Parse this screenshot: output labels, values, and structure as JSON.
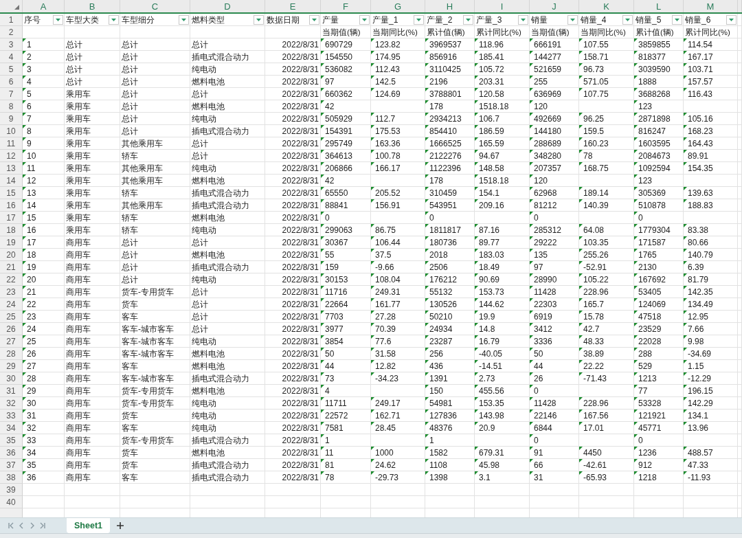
{
  "grid": {
    "columns": [
      {
        "letter": "A",
        "filter": true,
        "kind": "number"
      },
      {
        "letter": "B",
        "filter": true,
        "kind": "text"
      },
      {
        "letter": "C",
        "filter": true,
        "kind": "text"
      },
      {
        "letter": "D",
        "filter": true,
        "kind": "text"
      },
      {
        "letter": "E",
        "filter": true,
        "kind": "date"
      },
      {
        "letter": "F",
        "filter": true,
        "kind": "number"
      },
      {
        "letter": "G",
        "filter": true,
        "kind": "number"
      },
      {
        "letter": "H",
        "filter": true,
        "kind": "number"
      },
      {
        "letter": "I",
        "filter": true,
        "kind": "number"
      },
      {
        "letter": "J",
        "filter": true,
        "kind": "number"
      },
      {
        "letter": "K",
        "filter": true,
        "kind": "number"
      },
      {
        "letter": "L",
        "filter": true,
        "kind": "number"
      },
      {
        "letter": "M",
        "filter": true,
        "kind": "number"
      }
    ],
    "rows": [
      {
        "number": "1",
        "kind": "header",
        "cells": [
          "序号",
          "车型大类",
          "车型细分",
          "燃料类型",
          "数据日期",
          "产量",
          "产量_1",
          "产量_2",
          "产量_3",
          "销量",
          "销量_4",
          "销量_5",
          "销量_6"
        ]
      },
      {
        "number": "2",
        "kind": "subheader",
        "cells": [
          null,
          null,
          null,
          null,
          null,
          "当期值(辆)",
          "当期同比(%)",
          "累计值(辆)",
          "累计同比(%)",
          "当期值(辆)",
          "当期同比(%)",
          "累计值(辆)",
          "累计同比(%)"
        ]
      },
      {
        "number": "3",
        "kind": "data",
        "cells": [
          "1",
          "总计",
          "总计",
          "总计",
          "2022/8/31",
          "690729",
          "123.82",
          "3969537",
          "118.96",
          "666191",
          "107.55",
          "3859855",
          "114.54"
        ]
      },
      {
        "number": "4",
        "kind": "data",
        "cells": [
          "2",
          "总计",
          "总计",
          "插电式混合动力",
          "2022/8/31",
          "154550",
          "174.95",
          "856916",
          "185.41",
          "144277",
          "158.71",
          "818377",
          "167.17"
        ]
      },
      {
        "number": "5",
        "kind": "data",
        "cells": [
          "3",
          "总计",
          "总计",
          "纯电动",
          "2022/8/31",
          "536082",
          "112.43",
          "3110425",
          "105.72",
          "521659",
          "96.73",
          "3039590",
          "103.71"
        ]
      },
      {
        "number": "6",
        "kind": "data",
        "cells": [
          "4",
          "总计",
          "总计",
          "燃料电池",
          "2022/8/31",
          "97",
          "142.5",
          "2196",
          "203.31",
          "255",
          "571.05",
          "1888",
          "157.57"
        ]
      },
      {
        "number": "7",
        "kind": "data",
        "cells": [
          "5",
          "乘用车",
          "总计",
          "总计",
          "2022/8/31",
          "660362",
          "124.69",
          "3788801",
          "120.58",
          "636969",
          "107.75",
          "3688268",
          "116.43"
        ]
      },
      {
        "number": "8",
        "kind": "data",
        "cells": [
          "6",
          "乘用车",
          "总计",
          "燃料电池",
          "2022/8/31",
          "42",
          null,
          "178",
          "1518.18",
          "120",
          null,
          "123",
          null
        ]
      },
      {
        "number": "9",
        "kind": "data",
        "cells": [
          "7",
          "乘用车",
          "总计",
          "纯电动",
          "2022/8/31",
          "505929",
          "112.7",
          "2934213",
          "106.7",
          "492669",
          "96.25",
          "2871898",
          "105.16"
        ]
      },
      {
        "number": "10",
        "kind": "data",
        "cells": [
          "8",
          "乘用车",
          "总计",
          "插电式混合动力",
          "2022/8/31",
          "154391",
          "175.53",
          "854410",
          "186.59",
          "144180",
          "159.5",
          "816247",
          "168.23"
        ]
      },
      {
        "number": "11",
        "kind": "data",
        "cells": [
          "9",
          "乘用车",
          "其他乘用车",
          "总计",
          "2022/8/31",
          "295749",
          "163.36",
          "1666525",
          "165.59",
          "288689",
          "160.23",
          "1603595",
          "164.43"
        ]
      },
      {
        "number": "12",
        "kind": "data",
        "cells": [
          "10",
          "乘用车",
          "轿车",
          "总计",
          "2022/8/31",
          "364613",
          "100.78",
          "2122276",
          "94.67",
          "348280",
          "78",
          "2084673",
          "89.91"
        ]
      },
      {
        "number": "13",
        "kind": "data",
        "cells": [
          "11",
          "乘用车",
          "其他乘用车",
          "纯电动",
          "2022/8/31",
          "206866",
          "166.17",
          "1122396",
          "148.58",
          "207357",
          "168.75",
          "1092594",
          "154.35"
        ]
      },
      {
        "number": "14",
        "kind": "data",
        "cells": [
          "12",
          "乘用车",
          "其他乘用车",
          "燃料电池",
          "2022/8/31",
          "42",
          null,
          "178",
          "1518.18",
          "120",
          null,
          "123",
          null
        ]
      },
      {
        "number": "15",
        "kind": "data",
        "cells": [
          "13",
          "乘用车",
          "轿车",
          "插电式混合动力",
          "2022/8/31",
          "65550",
          "205.52",
          "310459",
          "154.1",
          "62968",
          "189.14",
          "305369",
          "139.63"
        ]
      },
      {
        "number": "16",
        "kind": "data",
        "cells": [
          "14",
          "乘用车",
          "其他乘用车",
          "插电式混合动力",
          "2022/8/31",
          "88841",
          "156.91",
          "543951",
          "209.16",
          "81212",
          "140.39",
          "510878",
          "188.83"
        ]
      },
      {
        "number": "17",
        "kind": "data",
        "cells": [
          "15",
          "乘用车",
          "轿车",
          "燃料电池",
          "2022/8/31",
          "0",
          null,
          "0",
          null,
          "0",
          null,
          "0",
          null
        ]
      },
      {
        "number": "18",
        "kind": "data",
        "cells": [
          "16",
          "乘用车",
          "轿车",
          "纯电动",
          "2022/8/31",
          "299063",
          "86.75",
          "1811817",
          "87.16",
          "285312",
          "64.08",
          "1779304",
          "83.38"
        ]
      },
      {
        "number": "19",
        "kind": "data",
        "cells": [
          "17",
          "商用车",
          "总计",
          "总计",
          "2022/8/31",
          "30367",
          "106.44",
          "180736",
          "89.77",
          "29222",
          "103.35",
          "171587",
          "80.66"
        ]
      },
      {
        "number": "20",
        "kind": "data",
        "cells": [
          "18",
          "商用车",
          "总计",
          "燃料电池",
          "2022/8/31",
          "55",
          "37.5",
          "2018",
          "183.03",
          "135",
          "255.26",
          "1765",
          "140.79"
        ]
      },
      {
        "number": "21",
        "kind": "data",
        "cells": [
          "19",
          "商用车",
          "总计",
          "插电式混合动力",
          "2022/8/31",
          "159",
          "-9.66",
          "2506",
          "18.49",
          "97",
          "-52.91",
          "2130",
          "6.39"
        ]
      },
      {
        "number": "22",
        "kind": "data",
        "cells": [
          "20",
          "商用车",
          "总计",
          "纯电动",
          "2022/8/31",
          "30153",
          "108.04",
          "176212",
          "90.69",
          "28990",
          "105.22",
          "167692",
          "81.79"
        ]
      },
      {
        "number": "23",
        "kind": "data",
        "cells": [
          "21",
          "商用车",
          "货车-专用货车",
          "总计",
          "2022/8/31",
          "11716",
          "249.31",
          "55132",
          "153.73",
          "11428",
          "228.96",
          "53405",
          "142.35"
        ]
      },
      {
        "number": "24",
        "kind": "data",
        "cells": [
          "22",
          "商用车",
          "货车",
          "总计",
          "2022/8/31",
          "22664",
          "161.77",
          "130526",
          "144.62",
          "22303",
          "165.7",
          "124069",
          "134.49"
        ]
      },
      {
        "number": "25",
        "kind": "data",
        "cells": [
          "23",
          "商用车",
          "客车",
          "总计",
          "2022/8/31",
          "7703",
          "27.28",
          "50210",
          "19.9",
          "6919",
          "15.78",
          "47518",
          "12.95"
        ]
      },
      {
        "number": "26",
        "kind": "data",
        "cells": [
          "24",
          "商用车",
          "客车-城市客车",
          "总计",
          "2022/8/31",
          "3977",
          "70.39",
          "24934",
          "14.8",
          "3412",
          "42.7",
          "23529",
          "7.66"
        ]
      },
      {
        "number": "27",
        "kind": "data",
        "cells": [
          "25",
          "商用车",
          "客车-城市客车",
          "纯电动",
          "2022/8/31",
          "3854",
          "77.6",
          "23287",
          "16.79",
          "3336",
          "48.33",
          "22028",
          "9.98"
        ]
      },
      {
        "number": "28",
        "kind": "data",
        "cells": [
          "26",
          "商用车",
          "客车-城市客车",
          "燃料电池",
          "2022/8/31",
          "50",
          "31.58",
          "256",
          "-40.05",
          "50",
          "38.89",
          "288",
          "-34.69"
        ]
      },
      {
        "number": "29",
        "kind": "data",
        "cells": [
          "27",
          "商用车",
          "客车",
          "燃料电池",
          "2022/8/31",
          "44",
          "12.82",
          "436",
          "-14.51",
          "44",
          "22.22",
          "529",
          "1.15"
        ]
      },
      {
        "number": "30",
        "kind": "data",
        "cells": [
          "28",
          "商用车",
          "客车-城市客车",
          "插电式混合动力",
          "2022/8/31",
          "73",
          "-34.23",
          "1391",
          "2.73",
          "26",
          "-71.43",
          "1213",
          "-12.29"
        ]
      },
      {
        "number": "31",
        "kind": "data",
        "cells": [
          "29",
          "商用车",
          "货车-专用货车",
          "燃料电池",
          "2022/8/31",
          "4",
          null,
          "150",
          "455.56",
          "0",
          null,
          "77",
          "196.15"
        ]
      },
      {
        "number": "32",
        "kind": "data",
        "cells": [
          "30",
          "商用车",
          "货车-专用货车",
          "纯电动",
          "2022/8/31",
          "11711",
          "249.17",
          "54981",
          "153.35",
          "11428",
          "228.96",
          "53328",
          "142.29"
        ]
      },
      {
        "number": "33",
        "kind": "data",
        "cells": [
          "31",
          "商用车",
          "货车",
          "纯电动",
          "2022/8/31",
          "22572",
          "162.71",
          "127836",
          "143.98",
          "22146",
          "167.56",
          "121921",
          "134.1"
        ]
      },
      {
        "number": "34",
        "kind": "data",
        "cells": [
          "32",
          "商用车",
          "客车",
          "纯电动",
          "2022/8/31",
          "7581",
          "28.45",
          "48376",
          "20.9",
          "6844",
          "17.01",
          "45771",
          "13.96"
        ]
      },
      {
        "number": "35",
        "kind": "data",
        "cells": [
          "33",
          "商用车",
          "货车-专用货车",
          "插电式混合动力",
          "2022/8/31",
          "1",
          null,
          "1",
          null,
          "0",
          null,
          "0",
          null
        ]
      },
      {
        "number": "36",
        "kind": "data",
        "cells": [
          "34",
          "商用车",
          "货车",
          "燃料电池",
          "2022/8/31",
          "11",
          "1000",
          "1582",
          "679.31",
          "91",
          "4450",
          "1236",
          "488.57"
        ]
      },
      {
        "number": "37",
        "kind": "data",
        "cells": [
          "35",
          "商用车",
          "货车",
          "插电式混合动力",
          "2022/8/31",
          "81",
          "24.62",
          "1108",
          "45.98",
          "66",
          "-42.61",
          "912",
          "47.33"
        ]
      },
      {
        "number": "38",
        "kind": "data",
        "cells": [
          "36",
          "商用车",
          "客车",
          "插电式混合动力",
          "2022/8/31",
          "78",
          "-29.73",
          "1398",
          "3.1",
          "31",
          "-65.93",
          "1218",
          "-11.93"
        ]
      },
      {
        "number": "39",
        "kind": "data"
      },
      {
        "number": "40",
        "kind": "data"
      }
    ]
  },
  "sheets": [
    {
      "name": "Sheet1",
      "selected": true
    }
  ]
}
